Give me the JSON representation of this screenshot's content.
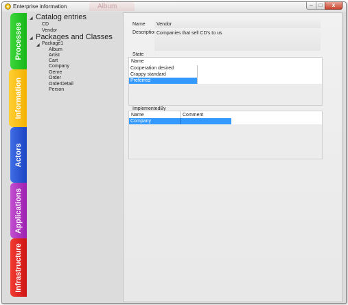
{
  "window": {
    "title": "Enterprise information",
    "ghost_tab": "Album"
  },
  "controls": {
    "minimize": "–",
    "maximize": "□",
    "close": "x"
  },
  "side_tabs": [
    "Processes",
    "Information",
    "Actors",
    "Applications",
    "Infrastructure"
  ],
  "tree": {
    "catalog": {
      "label": "Catalog entries",
      "items": [
        "CD",
        "Vendor"
      ]
    },
    "packages": {
      "label": "Packages and Classes",
      "package": "Package1",
      "items": [
        "Album",
        "Artist",
        "Cart",
        "Company",
        "Genre",
        "Order",
        "OrderDetail",
        "Person"
      ]
    }
  },
  "details": {
    "name_label": "Name",
    "name_value": "Vendor",
    "description_label": "Description",
    "description_value": "Companies that sell CD's to us"
  },
  "state": {
    "label": "State",
    "column": "Name",
    "rows": [
      "Cooperation desired",
      "Crappy standard",
      "Preferred"
    ]
  },
  "implemented_by": {
    "label": "ImplementedBy",
    "columns": [
      "Name",
      "Comment"
    ],
    "rows": [
      {
        "name": "Company",
        "comment": ""
      }
    ]
  },
  "colors": {
    "selection": "#3399ff"
  }
}
